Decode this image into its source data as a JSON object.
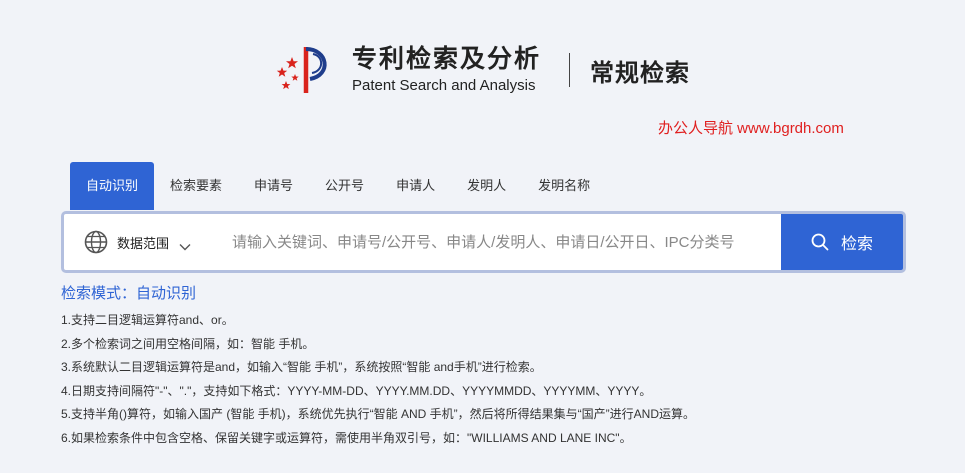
{
  "header": {
    "logo_title": "专利检索及分析",
    "logo_subtitle": "Patent Search and Analysis",
    "page_title": "常规检索",
    "logo_colors": {
      "red": "#d9231d",
      "blue": "#1f3d8c"
    }
  },
  "watermark": "办公人导航 www.bgrdh.com",
  "tabs": [
    {
      "label": "自动识别",
      "active": true
    },
    {
      "label": "检索要素",
      "active": false
    },
    {
      "label": "申请号",
      "active": false
    },
    {
      "label": "公开号",
      "active": false
    },
    {
      "label": "申请人",
      "active": false
    },
    {
      "label": "发明人",
      "active": false
    },
    {
      "label": "发明名称",
      "active": false
    }
  ],
  "search": {
    "scope_label": "数据范围",
    "scope_icon": "globe-icon",
    "placeholder": "请输入关键词、申请号/公开号、申请人/发明人、申请日/公开日、IPC分类号",
    "value": "",
    "button_label": "检索",
    "button_icon": "search-icon",
    "accent_color": "#2f64d4"
  },
  "help": {
    "mode_line": "检索模式：自动识别",
    "items": [
      "1.支持二目逻辑运算符and、or。",
      "2.多个检索词之间用空格间隔，如：智能 手机。",
      "3.系统默认二目逻辑运算符是and，如输入“智能 手机”，系统按照“智能 and手机”进行检索。",
      "4.日期支持间隔符\"-\"、\".\"，支持如下格式：YYYY-MM-DD、YYYY.MM.DD、YYYYMMDD、YYYYMM、YYYY。",
      "5.支持半角()算符，如输入国产 (智能 手机)，系统优先执行“智能 AND 手机”，然后将所得结果集与“国产”进行AND运算。",
      "6.如果检索条件中包含空格、保留关键字或运算符，需使用半角双引号，如：\"WILLIAMS AND LANE INC\"。"
    ]
  }
}
